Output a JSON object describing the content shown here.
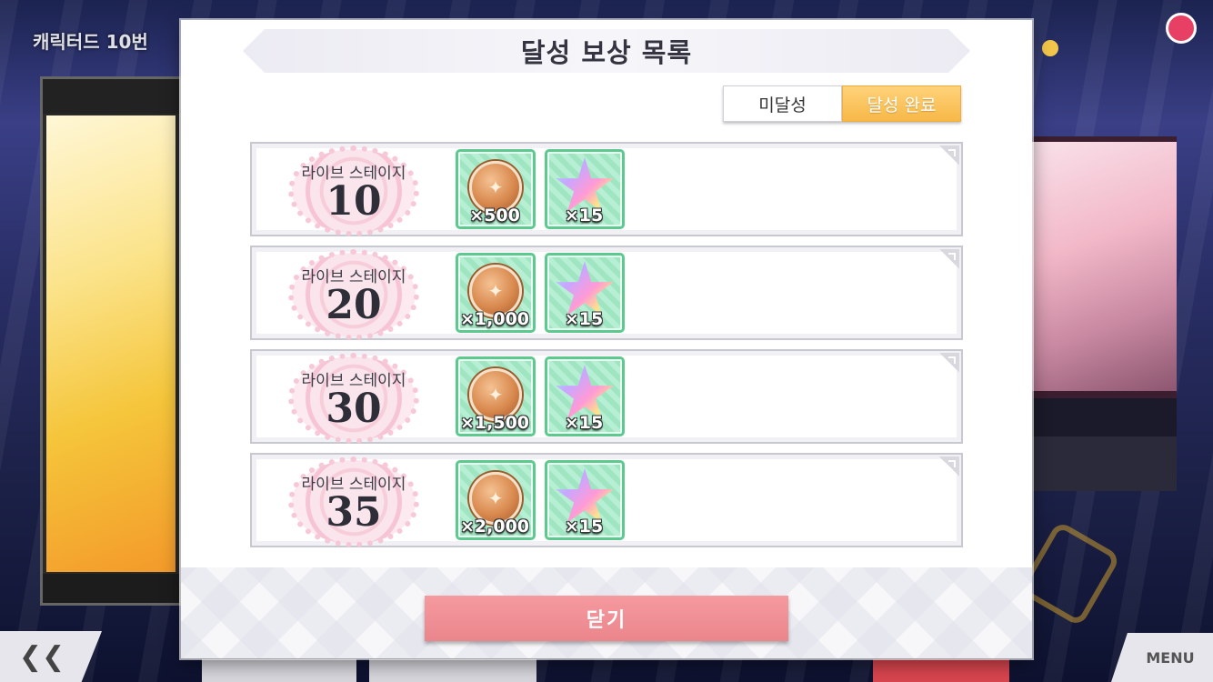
{
  "background": {
    "top_text": "캐릭터드 10번",
    "back_label": "❮❮",
    "menu_label": "MENU"
  },
  "modal": {
    "title": "달성 보상 목록",
    "tabs": [
      {
        "label": "미달성",
        "active": false
      },
      {
        "label": "달성 완료",
        "active": true
      }
    ],
    "rows": [
      {
        "stage_label": "라이브 스테이지",
        "stage_number": "10",
        "rewards": [
          {
            "icon": "coin-icon",
            "quantity": "×500"
          },
          {
            "icon": "star-gem-icon",
            "quantity": "×15"
          }
        ]
      },
      {
        "stage_label": "라이브 스테이지",
        "stage_number": "20",
        "rewards": [
          {
            "icon": "coin-icon",
            "quantity": "×1,000"
          },
          {
            "icon": "star-gem-icon",
            "quantity": "×15"
          }
        ]
      },
      {
        "stage_label": "라이브 스테이지",
        "stage_number": "30",
        "rewards": [
          {
            "icon": "coin-icon",
            "quantity": "×1,500"
          },
          {
            "icon": "star-gem-icon",
            "quantity": "×15"
          }
        ]
      },
      {
        "stage_label": "라이브 스테이지",
        "stage_number": "35",
        "rewards": [
          {
            "icon": "coin-icon",
            "quantity": "×2,000"
          },
          {
            "icon": "star-gem-icon",
            "quantity": "×15"
          }
        ]
      }
    ],
    "close_label": "닫기"
  },
  "colors": {
    "accent_tab": "#f7b847",
    "close_button": "#ea868c",
    "item_border": "#5ec98f"
  }
}
